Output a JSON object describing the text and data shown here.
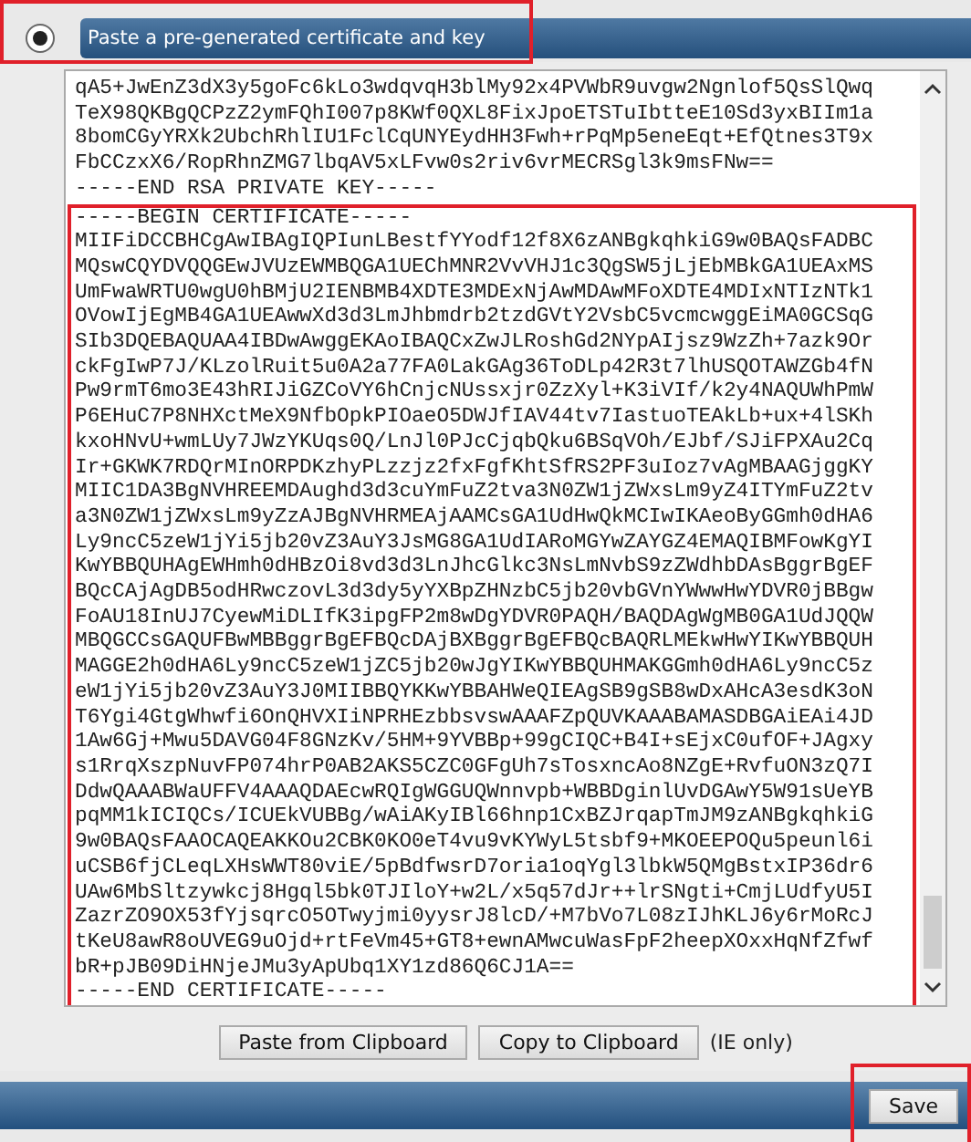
{
  "section": {
    "title": "Paste a pre-generated certificate and key",
    "selected": true
  },
  "textarea": {
    "key_lines": [
      "qA5+JwEnZ3dX3y5goFc6kLo3wdqvqH3blMy92x4PVWbR9uvgw2Ngnlof5QsSlQwq",
      "TeX98QKBgQCPzZ2ymFQhI007p8KWf0QXL8FixJpoETSTuIbtteE10Sd3yxBIIm1a",
      "8bomCGyYRXk2UbchRhlIU1FclCqUNYEydHH3Fwh+rPqMp5eneEqt+EfQtnes3T9x",
      "FbCCzxX6/RopRhnZMG7lbqAV5xLFvw0s2riv6vrMECRSgl3k9msFNw==",
      "-----END RSA PRIVATE KEY-----"
    ],
    "certificate_lines": [
      "-----BEGIN CERTIFICATE-----",
      "MIIFiDCCBHCgAwIBAgIQPIunLBestfYYodf12f8X6zANBgkqhkiG9w0BAQsFADBC",
      "MQswCQYDVQQGEwJVUzEWMBQGA1UEChMNR2VvVHJ1c3QgSW5jLjEbMBkGA1UEAxMS",
      "UmFwaWRTU0wgU0hBMjU2IENBMB4XDTE3MDExNjAwMDAwMFoXDTE4MDIxNTIzNTk1",
      "OVowIjEgMB4GA1UEAwwXd3d3LmJhbmdrb2tzdGVtY2VsbC5vcmcwggEiMA0GCSqG",
      "SIb3DQEBAQUAA4IBDwAwggEKAoIBAQCxZwJLRoshGd2NYpAIjsz9WzZh+7azk9Or",
      "ckFgIwP7J/KLzolRuit5u0A2a77FA0LakGAg36ToDLp42R3t7lhUSQOTAWZGb4fN",
      "Pw9rmT6mo3E43hRIJiGZCoVY6hCnjcNUssxjr0ZzXyl+K3iVIf/k2y4NAQUWhPmW",
      "P6EHuC7P8NHXctMeX9NfbOpkPIOaeO5DWJfIAV44tv7IastuoTEAkLb+ux+4lSKh",
      "kxoHNvU+wmLUy7JWzYKUqs0Q/LnJl0PJcCjqbQku6BSqVOh/EJbf/SJiFPXAu2Cq",
      "Ir+GKWK7RDQrMInORPDKzhyPLzzjz2fxFgfKhtSfRS2PF3uIoz7vAgMBAAGjggKY",
      "MIIC1DA3BgNVHREEMDAughd3d3cuYmFuZ2tva3N0ZW1jZWxsLm9yZ4ITYmFuZ2tv",
      "a3N0ZW1jZWxsLm9yZzAJBgNVHRMEAjAAMCsGA1UdHwQkMCIwIKAeoByGGmh0dHA6",
      "Ly9ncC5zeW1jYi5jb20vZ3AuY3JsMG8GA1UdIARoMGYwZAYGZ4EMAQIBMFowKgYI",
      "KwYBBQUHAgEWHmh0dHBzOi8vd3d3LnJhcGlkc3NsLmNvbS9zZWdhbDAsBggrBgEF",
      "BQcCAjAgDB5odHRwczovL3d3dy5yYXBpZHNzbC5jb20vbGVnYWwwHwYDVR0jBBgw",
      "FoAU18InUJ7CyewMiDLIfK3ipgFP2m8wDgYDVR0PAQH/BAQDAgWgMB0GA1UdJQQW",
      "MBQGCCsGAQUFBwMBBggrBgEFBQcDAjBXBggrBgEFBQcBAQRLMEkwHwYIKwYBBQUH",
      "MAGGE2h0dHA6Ly9ncC5zeW1jZC5jb20wJgYIKwYBBQUHMAKGGmh0dHA6Ly9ncC5z",
      "eW1jYi5jb20vZ3AuY3J0MIIBBQYKKwYBBAHWeQIEAgSB9gSB8wDxAHcA3esdK3oN",
      "T6Ygi4GtgWhwfi6OnQHVXIiNPRHEzbbsvswAAAFZpQUVKAAABAMASDBGAiEAi4JD",
      "1Aw6Gj+Mwu5DAVG04F8GNzKv/5HM+9YVBBp+99gCIQC+B4I+sEjxC0ufOF+JAgxy",
      "s1RrqXszpNuvFP074hrP0AB2AKS5CZC0GFgUh7sTosxncAo8NZgE+RvfuON3zQ7I",
      "DdwQAAABWaUFFV4AAAQDAEcwRQIgWGGUQWnnvpb+WBBDginlUvDGAwY5W91sUeYB",
      "pqMM1kICIQCs/ICUEkVUBBg/wAiAKyIBl66hnp1CxBZJrqapTmJM9zANBgkqhkiG",
      "9w0BAQsFAAOCAQEAKKOu2CBK0KO0eT4vu9vKYWyL5tsbf9+MKOEEPOQu5peunl6i",
      "uCSB6fjCLeqLXHsWWT80viE/5pBdfwsrD7oria1oqYgl3lbkW5QMgBstxIP36dr6",
      "UAw6MbSltzywkcj8Hgql5bk0TJIloY+w2L/x5q57dJr++lrSNgti+CmjLUdfyU5I",
      "ZazrZO9OX53fYjsqrcO5OTwyjmi0yysrJ8lcD/+M7bVo7L08zIJhKLJ6y6rMoRcJ",
      "tKeU8awR8oUVEG9uOjd+rtFeVm45+GT8+ewnAMwcuWasFpF2heepXOxxHqNfZfwf",
      "bR+pJB09DiHNjeJMu3yApUbq1XY1zd86Q6CJ1A==",
      "-----END CERTIFICATE-----"
    ]
  },
  "buttons": [
    {
      "label": "Paste from Clipboard"
    },
    {
      "label": "Copy to Clipboard"
    }
  ],
  "note": "(IE only)",
  "footer": {
    "save_label": "Save"
  }
}
